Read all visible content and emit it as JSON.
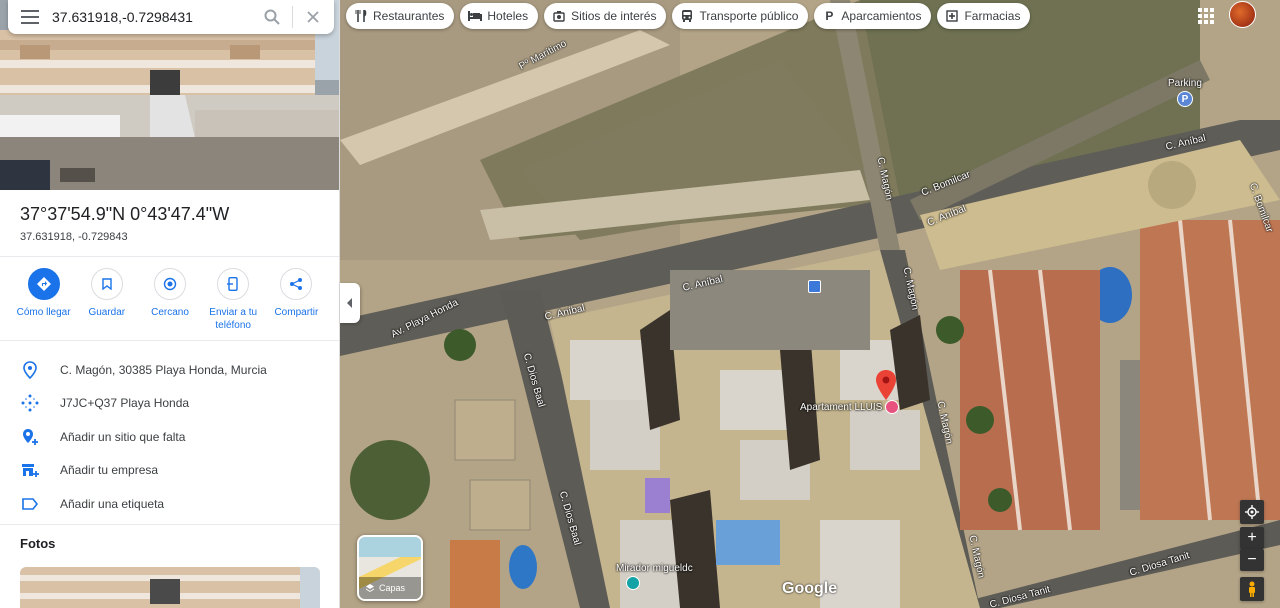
{
  "search": {
    "value": "37.631918,-0.7298431"
  },
  "location": {
    "dms": "37°37'54.9\"N 0°43'47.4\"W",
    "decimal": "37.631918, -0.729843"
  },
  "actions": [
    {
      "label": "Cómo llegar",
      "icon": "directions-icon"
    },
    {
      "label": "Guardar",
      "icon": "bookmark-icon"
    },
    {
      "label": "Cercano",
      "icon": "nearby-icon"
    },
    {
      "label": "Enviar a tu teléfono",
      "icon": "send-to-phone-icon"
    },
    {
      "label": "Compartir",
      "icon": "share-icon"
    }
  ],
  "details": [
    {
      "text": "C. Magón, 30385 Playa Honda, Murcia",
      "icon": "location-pin-icon"
    },
    {
      "text": "J7JC+Q37 Playa Honda",
      "icon": "plus-code-icon"
    },
    {
      "text": "Añadir un sitio que falta",
      "icon": "add-place-icon"
    },
    {
      "text": "Añadir tu empresa",
      "icon": "add-business-icon"
    },
    {
      "text": "Añadir una etiqueta",
      "icon": "label-icon"
    }
  ],
  "fotos_title": "Fotos",
  "chips": [
    {
      "label": "Restaurantes",
      "icon": "restaurant-icon"
    },
    {
      "label": "Hoteles",
      "icon": "hotel-icon"
    },
    {
      "label": "Sitios de interés",
      "icon": "attraction-icon"
    },
    {
      "label": "Transporte público",
      "icon": "transit-icon"
    },
    {
      "label": "Aparcamientos",
      "icon": "parking-icon"
    },
    {
      "label": "Farmacias",
      "icon": "pharmacy-icon"
    }
  ],
  "map_labels": {
    "paseo": "Pº Marítimo",
    "aniball_left": "C. Aníbal",
    "aniball_mid": "C. Aníbal",
    "aniball_top": "C. Aníbal",
    "aniball_right": "C. Aníbal",
    "playa_honda": "Av. Playa Honda",
    "dios_baal_1": "C. Dios Baal",
    "dios_baal_2": "C. Dios Baal",
    "magon_1": "C. Magón",
    "magon_2": "C. Magón",
    "magon_3": "C. Magón",
    "magon_4": "C. Magón",
    "bomilcar_1": "C. Bomilcar",
    "bomilcar_2": "C. Bomilcar",
    "diosa_tanit_1": "C. Diosa Tanit",
    "diosa_tanit_2": "C. Diosa Tanit",
    "parking": "Parking",
    "poi": "Apartament LLUIS",
    "mirador": "Mirador migueldc",
    "layers": "Capas",
    "google": "Google"
  },
  "colors": {
    "accent": "#1a73e8",
    "pin": "#ea4335",
    "sand": "#b7a98c",
    "road": "#d6cfc0"
  }
}
